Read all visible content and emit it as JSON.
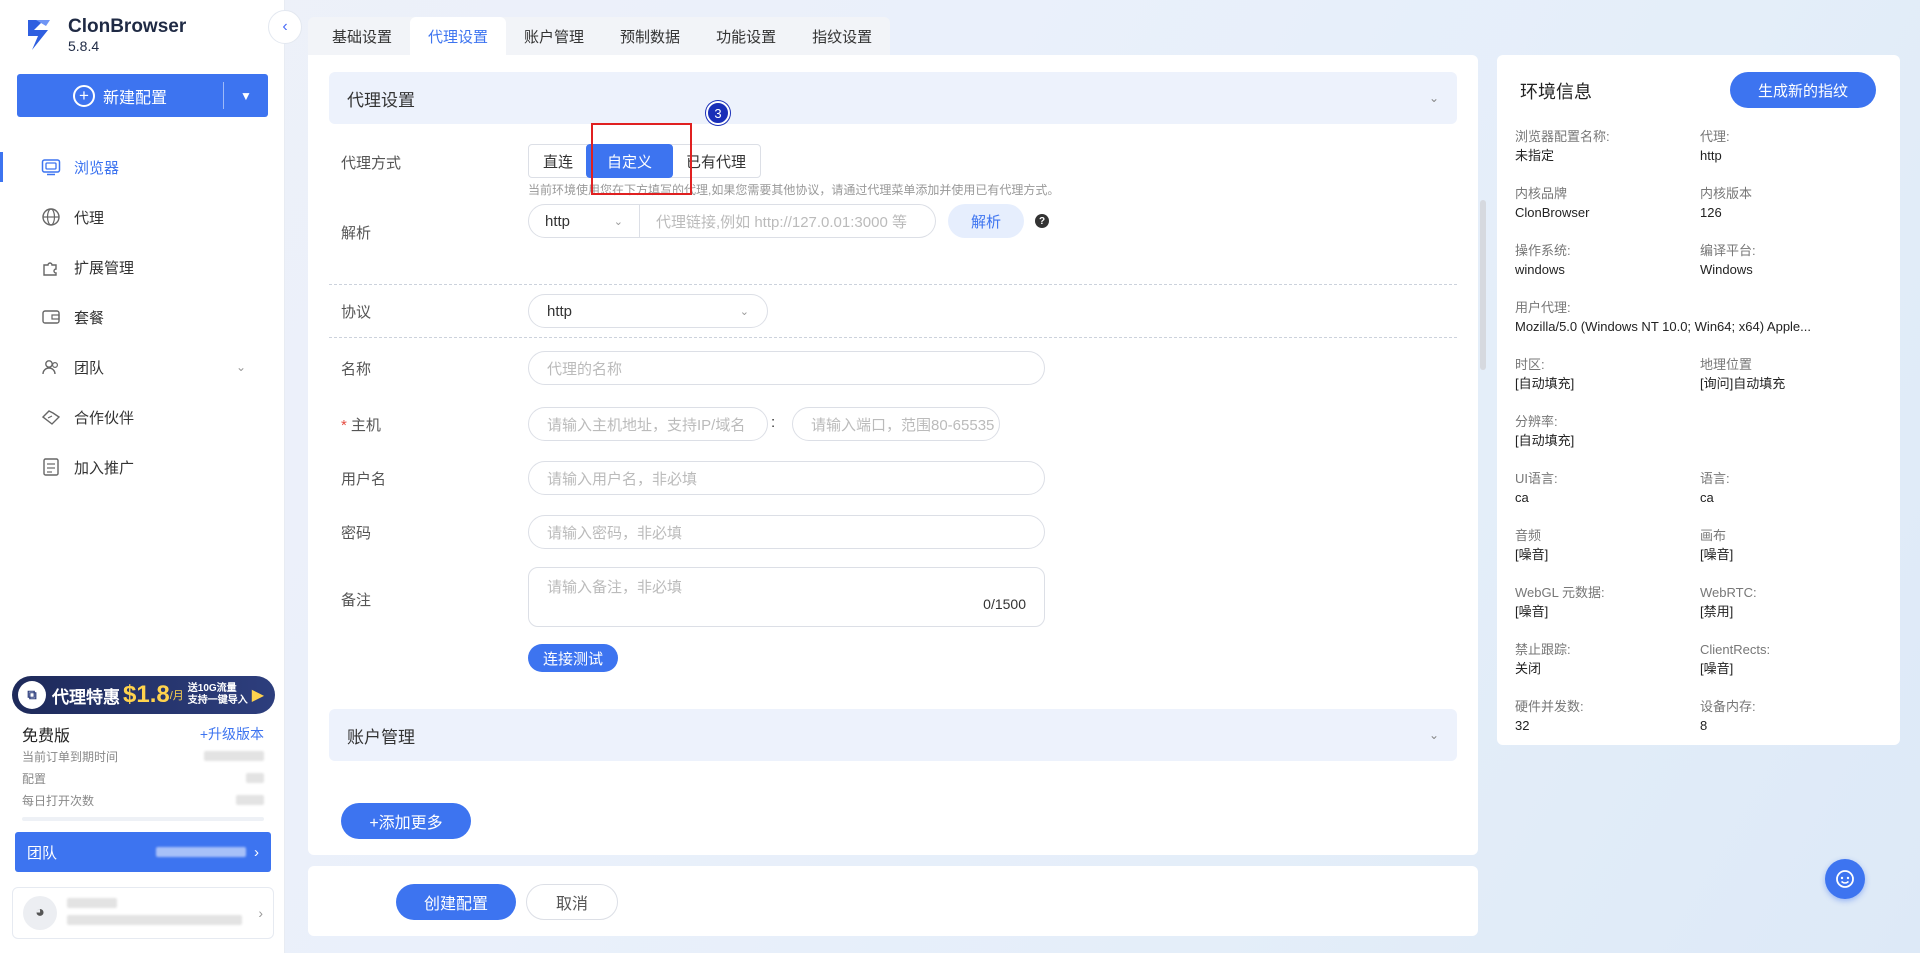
{
  "app": {
    "name": "ClonBrowser",
    "version": "5.8.4"
  },
  "sidebar": {
    "new_config_label": "新建配置",
    "items": [
      {
        "label": "浏览器",
        "icon": "browser-icon"
      },
      {
        "label": "代理",
        "icon": "globe-icon"
      },
      {
        "label": "扩展管理",
        "icon": "puzzle-icon"
      },
      {
        "label": "套餐",
        "icon": "wallet-icon"
      },
      {
        "label": "团队",
        "icon": "team-icon"
      },
      {
        "label": "合作伙伴",
        "icon": "handshake-icon"
      },
      {
        "label": "加入推广",
        "icon": "promo-doc-icon"
      }
    ],
    "promo": {
      "text": "代理特惠",
      "price": "$1.8",
      "per": "/月",
      "line1": "送10G流量",
      "line2": "支持一键导入"
    },
    "plan": {
      "name": "免费版",
      "upgrade": "+升级版本",
      "rows": [
        {
          "label": "当前订单到期时间"
        },
        {
          "label": "配置"
        },
        {
          "label": "每日打开次数"
        }
      ]
    },
    "team_label": "团队"
  },
  "tabs": [
    "基础设置",
    "代理设置",
    "账户管理",
    "预制数据",
    "功能设置",
    "指纹设置"
  ],
  "proxy": {
    "section_title": "代理设置",
    "mode_label": "代理方式",
    "modes": [
      "直连",
      "自定义",
      "已有代理"
    ],
    "step_badge": "3",
    "hint": "当前环境使用您在下方填写的代理,如果您需要其他协议，请通过代理菜单添加并使用已有代理方式。",
    "parse_label": "解析",
    "parse_protocol": "http",
    "parse_placeholder": "代理链接,例如 http://127.0.01:3000 等",
    "parse_button": "解析",
    "protocol_label": "协议",
    "protocol_value": "http",
    "name_label": "名称",
    "name_placeholder": "代理的名称",
    "host_label": "主机",
    "host_placeholder": "请输入主机地址，支持IP/域名",
    "port_placeholder": "请输入端口，范围80-65535",
    "colon": ":",
    "user_label": "用户名",
    "user_placeholder": "请输入用户名，非必填",
    "pass_label": "密码",
    "pass_placeholder": "请输入密码，非必填",
    "note_label": "备注",
    "note_placeholder": "请输入备注，非必填",
    "note_count": "0/1500",
    "test_button": "连接测试"
  },
  "account_section_title": "账户管理",
  "add_more": "+添加更多",
  "footer": {
    "create": "创建配置",
    "cancel": "取消"
  },
  "env": {
    "title": "环境信息",
    "generate": "生成新的指纹",
    "rows": [
      [
        {
          "k": "浏览器配置名称:",
          "v": "未指定"
        },
        {
          "k": "代理:",
          "v": "http"
        }
      ],
      [
        {
          "k": "内核品牌",
          "v": "ClonBrowser"
        },
        {
          "k": "内核版本",
          "v": "126"
        }
      ],
      [
        {
          "k": "操作系统:",
          "v": "windows"
        },
        {
          "k": "编译平台:",
          "v": "Windows"
        }
      ],
      [
        {
          "k": "用户代理:",
          "v": "Mozilla/5.0 (Windows NT 10.0; Win64; x64) Apple..."
        }
      ],
      [
        {
          "k": "时区:",
          "v": "[自动填充]"
        },
        {
          "k": "地理位置",
          "v": "[询问]自动填充"
        }
      ],
      [
        {
          "k": "分辨率:",
          "v": "[自动填充]"
        }
      ],
      [
        {
          "k": "UI语言:",
          "v": "ca"
        },
        {
          "k": "语言:",
          "v": "ca"
        }
      ],
      [
        {
          "k": "音频",
          "v": "[噪音]"
        },
        {
          "k": "画布",
          "v": "[噪音]"
        }
      ],
      [
        {
          "k": "WebGL 元数据:",
          "v": "[噪音]"
        },
        {
          "k": "WebRTC:",
          "v": "[禁用]"
        }
      ],
      [
        {
          "k": "禁止跟踪:",
          "v": "关闭"
        },
        {
          "k": "ClientRects:",
          "v": "[噪音]"
        }
      ],
      [
        {
          "k": "硬件并发数:",
          "v": "32"
        },
        {
          "k": "设备内存:",
          "v": "8"
        }
      ]
    ]
  },
  "colors": {
    "accent": "#3d74f0",
    "highlight": "#e02020",
    "badge": "#1a2fb8"
  }
}
